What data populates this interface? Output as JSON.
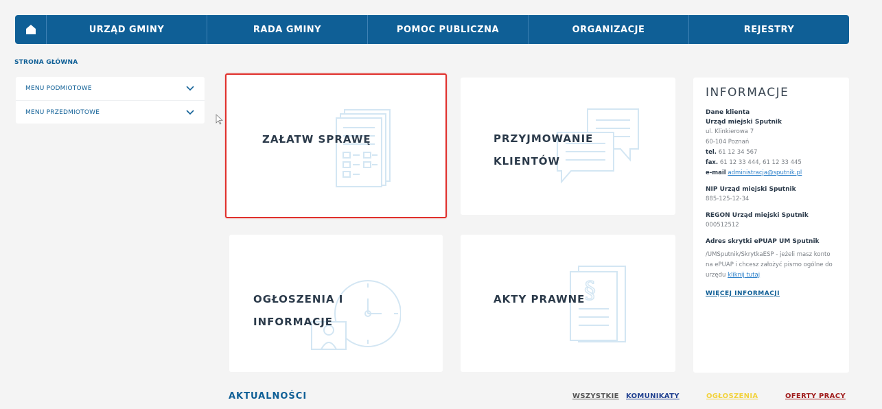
{
  "nav": {
    "home_icon": "home-icon",
    "items": [
      {
        "label": "URZĄD GMINY"
      },
      {
        "label": "RADA GMINY"
      },
      {
        "label": "POMOC PUBLICZNA"
      },
      {
        "label": "ORGANIZACJE"
      },
      {
        "label": "REJESTRY"
      }
    ]
  },
  "breadcrumb": "STRONA GŁÓWNA",
  "sidebar": {
    "items": [
      {
        "label": "MENU PODMIOTOWE"
      },
      {
        "label": "MENU PRZEDMIOTOWE"
      }
    ]
  },
  "tiles": [
    {
      "line1": "ZAŁATW SPRAWĘ",
      "line2": "",
      "icon": "documents-icon",
      "active": true
    },
    {
      "line1": "PRZYJMOWANIE",
      "line2": "KLIENTÓW",
      "icon": "chat-bubbles-icon",
      "active": false
    },
    {
      "line1": "OGŁOSZENIA I",
      "line2": "INFORMACJE",
      "icon": "clock-icon",
      "active": false
    },
    {
      "line1": "AKTY PRAWNE",
      "line2": "",
      "icon": "law-document-icon",
      "active": false
    }
  ],
  "info": {
    "title": "INFORMACJE",
    "client_label": "Dane klienta",
    "office_name": "Urząd miejski Sputnik",
    "street": "ul. Klinkierowa 7",
    "city": "60-104 Poznań",
    "tel_label": "tel.",
    "tel": "61 12 34 567",
    "fax_label": "fax.",
    "fax": "61 12 33 444, 61 12 33 445",
    "email_label": "e-mail",
    "email": "administracja@sputnik.pl",
    "nip_label": "NIP Urząd miejski Sputnik",
    "nip": "885-125-12-34",
    "regon_label": "REGON Urząd miejski Sputnik",
    "regon": "000512512",
    "epuap_label": "Adres skrytki ePUAP UM Sputnik",
    "epuap_text": "/UMSputnik/SkrytkaESP - jeżeli masz konto na ePUAP i chcesz założyć pismo ogólne do urzędu",
    "epuap_link": "kliknij tutaj",
    "more": "WIĘCEJ INFORMACJI"
  },
  "news": {
    "title": "AKTUALNOŚCI",
    "tabs": [
      {
        "label": "WSZYSTKIE",
        "color": "#555555"
      },
      {
        "label": "KOMUNIKATY",
        "color": "#1f3f8f"
      },
      {
        "label": "OGŁOSZENIA",
        "color": "#f2d23c"
      },
      {
        "label": "OFERTY PRACY",
        "color": "#a01c1c"
      }
    ]
  },
  "colors": {
    "primary": "#0f5f96",
    "active_border": "#e0302c",
    "icon_stroke": "#d3e6f3"
  }
}
